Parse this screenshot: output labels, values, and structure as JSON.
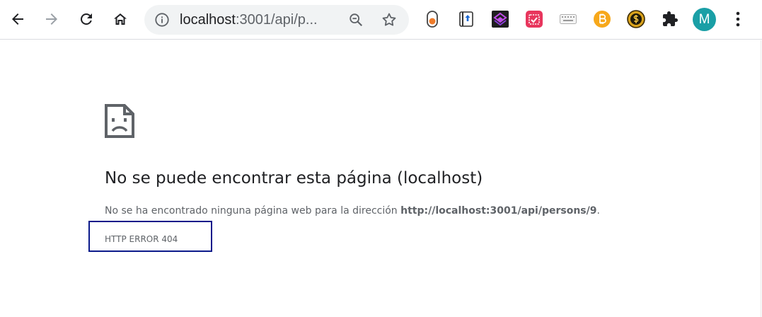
{
  "browser": {
    "url_host": "localhost",
    "url_rest": ":3001/api/p...",
    "nav": {
      "back_icon": "arrow-back-icon",
      "forward_icon": "arrow-forward-icon",
      "reload_icon": "reload-icon",
      "home_icon": "home-icon"
    },
    "omnibox_icons": [
      "info-icon",
      "zoom-out-icon",
      "star-icon"
    ],
    "extensions": [
      "toggle-extension-icon",
      "book-upload-extension-icon",
      "layers-extension-icon",
      "calendar-check-extension-icon",
      "keyboard-extension-icon",
      "bitcoin-extension-icon",
      "coin-extension-icon",
      "puzzle-extension-icon"
    ],
    "avatar_letter": "M",
    "avatar_color": "#1a9fa6"
  },
  "error": {
    "title": "No se puede encontrar esta página (localhost)",
    "desc_prefix": "No se ha encontrado ninguna página web para la dirección ",
    "desc_url": "http://localhost:3001/api/persons/9",
    "desc_suffix": ".",
    "code": "HTTP ERROR 404",
    "highlight_color": "#0b1a8a"
  }
}
